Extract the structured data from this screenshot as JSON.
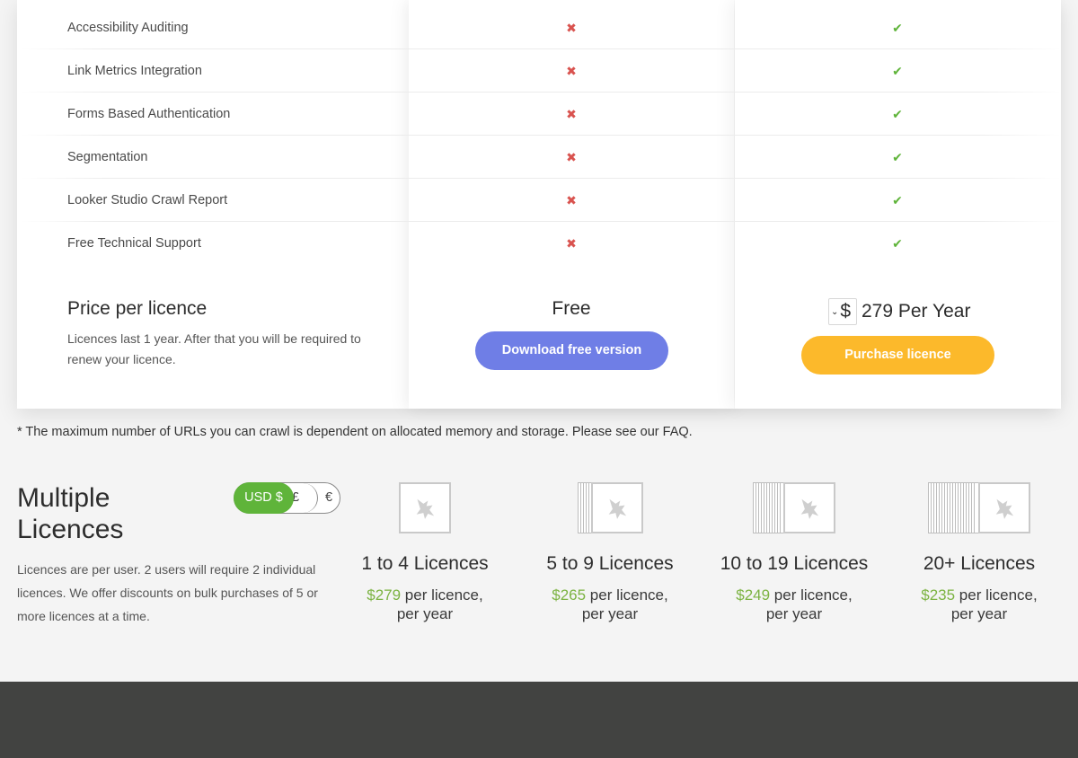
{
  "features": [
    {
      "name": "Accessibility Auditing",
      "free": false,
      "paid": true
    },
    {
      "name": "Link Metrics Integration",
      "free": false,
      "paid": true
    },
    {
      "name": "Forms Based Authentication",
      "free": false,
      "paid": true
    },
    {
      "name": "Segmentation",
      "free": false,
      "paid": true
    },
    {
      "name": "Looker Studio Crawl Report",
      "free": false,
      "paid": true
    },
    {
      "name": "Free Technical Support",
      "free": false,
      "paid": true
    }
  ],
  "icons": {
    "cross": "✖",
    "check": "✔"
  },
  "pricing": {
    "title": "Price per licence",
    "description": "Licences last 1 year. After that you will be required to renew your licence.",
    "free_label": "Free",
    "free_button": "Download free version",
    "currency_symbol": "$",
    "paid_amount": "279 Per Year",
    "paid_button": "Purchase licence"
  },
  "footnote": "* The maximum number of URLs you can crawl is dependent on allocated memory and storage. Please see our FAQ.",
  "multiple": {
    "title": "Multiple Licences",
    "description": "Licences are per user. 2 users will require 2 individual licences. We offer discounts on bulk purchases of 5 or more licences at a time.",
    "currency_toggle": {
      "selected": "USD $",
      "options": [
        "USD $",
        "£",
        "€"
      ]
    },
    "tiers": [
      {
        "label": "1 to 4 Licences",
        "price": "$279",
        "suffix": " per licence,",
        "suffix2": "per year"
      },
      {
        "label": "5 to 9 Licences",
        "price": "$265",
        "suffix": " per licence,",
        "suffix2": "per year"
      },
      {
        "label": "10 to 19 Licences",
        "price": "$249",
        "suffix": " per licence,",
        "suffix2": "per year"
      },
      {
        "label": "20+ Licences",
        "price": "$235",
        "suffix": " per licence,",
        "suffix2": "per year"
      }
    ]
  },
  "colors": {
    "accent_green": "#5fb43a",
    "price_green": "#7cb342",
    "cross_red": "#d9534f",
    "free_button": "#6f7ee6",
    "paid_button": "#fcb92b",
    "footer": "#424341"
  }
}
